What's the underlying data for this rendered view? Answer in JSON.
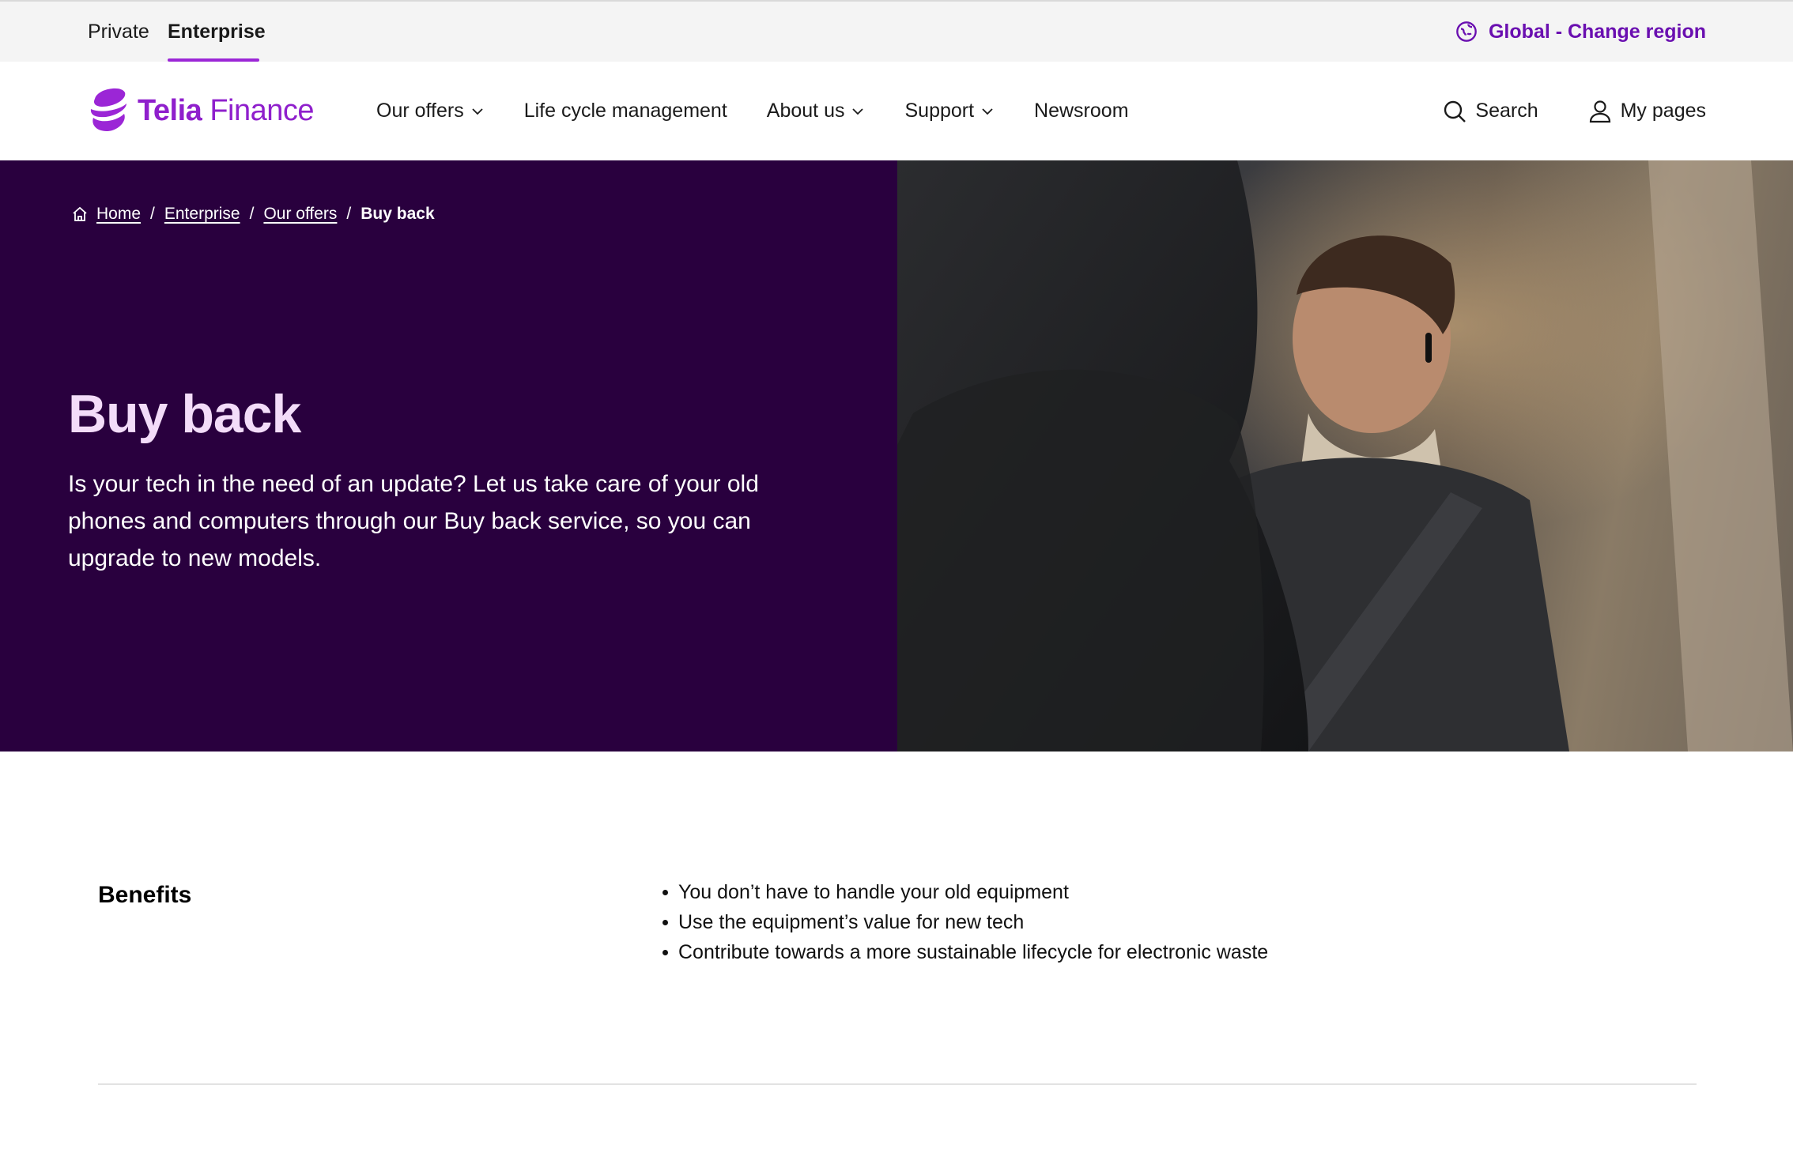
{
  "topbar": {
    "segments": [
      {
        "label": "Private",
        "active": false
      },
      {
        "label": "Enterprise",
        "active": true
      }
    ],
    "region_label": "Global - Change region",
    "region_icon": "globe-icon"
  },
  "header": {
    "logo": {
      "word1": "Telia",
      "word2": " Finance",
      "icon": "telia-pebble-logo"
    },
    "nav": [
      {
        "label": "Our offers",
        "has_dropdown": true
      },
      {
        "label": "Life cycle management",
        "has_dropdown": false
      },
      {
        "label": "About us",
        "has_dropdown": true
      },
      {
        "label": "Support",
        "has_dropdown": true
      },
      {
        "label": "Newsroom",
        "has_dropdown": false
      }
    ],
    "search_label": "Search",
    "mypages_label": "My pages"
  },
  "hero": {
    "breadcrumb": [
      {
        "label": "Home",
        "link": true
      },
      {
        "label": "Enterprise",
        "link": true
      },
      {
        "label": "Our offers",
        "link": true
      },
      {
        "label": "Buy back",
        "link": false
      }
    ],
    "breadcrumb_separator": "/",
    "title": "Buy back",
    "description": "Is your tech in the need of an update? Let us take care of your old phones and computers through our Buy back service, so you can upgrade to new models."
  },
  "benefits": {
    "title": "Benefits",
    "items": [
      "You don’t have to handle your old equipment",
      "Use the equipment’s value for new tech",
      "Contribute towards a more sustainable lifecycle for electronic waste"
    ]
  },
  "colors": {
    "brand_purple": "#9b26d6",
    "region_purple": "#6a0fb0",
    "hero_background": "#29003e",
    "hero_title": "#f3dcf9"
  }
}
